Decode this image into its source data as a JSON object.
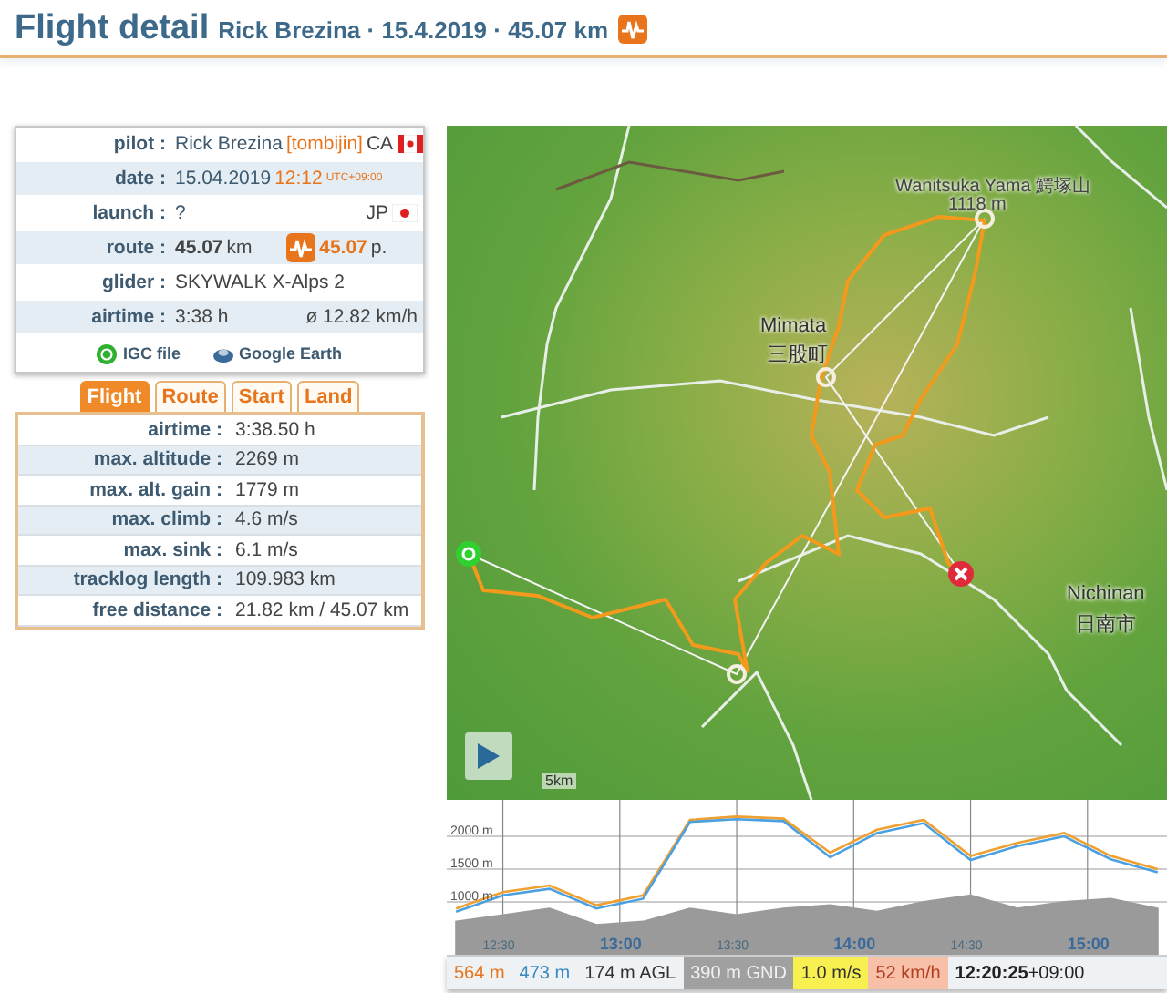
{
  "header": {
    "title": "Flight detail",
    "subtitle": "Rick Brezina · 15.4.2019 · 45.07 km"
  },
  "info": {
    "rows": [
      {
        "kind": "pilot",
        "label": "pilot :",
        "name": "Rick Brezina",
        "nickname": "[tombijin]",
        "country": "CA"
      },
      {
        "kind": "date",
        "label": "date :",
        "date": "15.04.2019",
        "time": "12:12",
        "timezone": "UTC+09:00"
      },
      {
        "kind": "launch",
        "label": "launch :",
        "site": "?",
        "country": "JP"
      },
      {
        "kind": "route",
        "label": "route :",
        "distance": "45.07",
        "unit": "km",
        "points": "45.07",
        "points_unit": "p."
      },
      {
        "kind": "glider",
        "label": "glider :",
        "value": "SKYWALK X-Alps 2"
      },
      {
        "kind": "airtime",
        "label": "airtime :",
        "value": "3:38 h",
        "speed": "ø 12.82 km/h"
      }
    ],
    "links": [
      {
        "kind": "igc",
        "label": "IGC file"
      },
      {
        "kind": "earth",
        "label": "Google Earth"
      }
    ]
  },
  "tabs": [
    {
      "label": "Flight",
      "selected": true
    },
    {
      "label": "Route",
      "selected": false
    },
    {
      "label": "Start",
      "selected": false
    },
    {
      "label": "Land",
      "selected": false
    }
  ],
  "stats": [
    {
      "label": "airtime :",
      "value": "3:38.50 h"
    },
    {
      "label": "max. altitude :",
      "value": "2269 m"
    },
    {
      "label": "max. alt. gain :",
      "value": "1779 m"
    },
    {
      "label": "max. climb :",
      "value": "4.6 m/s"
    },
    {
      "label": "max. sink :",
      "value": "6.1 m/s"
    },
    {
      "label": "tracklog length :",
      "value": "109.983 km"
    },
    {
      "label": "free distance :",
      "value": "21.82 km / 45.07 km"
    }
  ],
  "map": {
    "labels": [
      {
        "kind": "peak",
        "name": "Wanitsuka Yama 鰐塚山",
        "elevation": "1118 m"
      },
      {
        "kind": "town",
        "name": "Mimata",
        "local_name": "三股町"
      },
      {
        "kind": "city",
        "name": "Nichinan",
        "local_name": "日南市"
      }
    ],
    "scale": "5km"
  },
  "profile": {
    "chart_data": {
      "type": "line",
      "grid": true,
      "x": [
        12.3,
        12.5,
        12.7,
        12.9,
        13.1,
        13.3,
        13.5,
        13.7,
        13.9,
        14.1,
        14.3,
        14.5,
        14.7,
        14.9,
        15.1,
        15.3
      ],
      "xlim": [
        12.26,
        15.34
      ],
      "ylim": [
        195,
        2555
      ],
      "xticks": [
        {
          "value": 12.5,
          "label": "12:30"
        },
        {
          "value": 13,
          "label": "13:00"
        },
        {
          "value": 13.5,
          "label": "13:30"
        },
        {
          "value": 14,
          "label": "14:00"
        },
        {
          "value": 14.5,
          "label": "14:30"
        },
        {
          "value": 15,
          "label": "15:00"
        }
      ],
      "yticks": [
        {
          "value": 1000,
          "label": "1000 m"
        },
        {
          "value": 1500,
          "label": "1500 m"
        },
        {
          "value": 2000,
          "label": "2000 m"
        }
      ],
      "series": [
        {
          "type": "area",
          "color": "#9a9a9a",
          "values": [
            700,
            800,
            900,
            650,
            700,
            900,
            800,
            900,
            950,
            850,
            1000,
            1100,
            900,
            1000,
            1050,
            900
          ]
        },
        {
          "color": "#f0a030",
          "values": [
            900,
            1150,
            1250,
            950,
            1100,
            2250,
            2300,
            2270,
            1750,
            2100,
            2250,
            1700,
            1900,
            2050,
            1700,
            1500
          ]
        },
        {
          "color": "#4aa0e0",
          "values": [
            850,
            1100,
            1200,
            900,
            1050,
            2220,
            2260,
            2230,
            1680,
            2050,
            2200,
            1640,
            1850,
            2000,
            1650,
            1450
          ]
        }
      ]
    }
  },
  "status": [
    {
      "kind": "gps",
      "text": "564 m"
    },
    {
      "kind": "baro",
      "text": "473 m"
    },
    {
      "kind": "agl",
      "text": "174 m AGL"
    },
    {
      "kind": "gnd",
      "text": "390 m GND"
    },
    {
      "kind": "vario",
      "text": "1.0 m/s"
    },
    {
      "kind": "speed",
      "text": "52 km/h"
    },
    {
      "kind": "time",
      "text": "**12:20:25**+09:00"
    }
  ]
}
